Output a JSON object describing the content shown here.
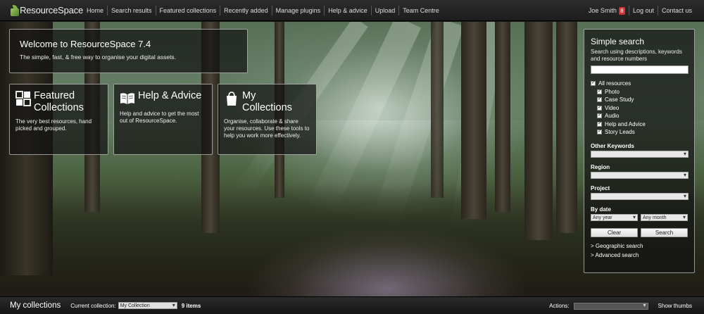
{
  "app": {
    "logo_text": "ResourceSpace"
  },
  "nav": {
    "items": [
      "Home",
      "Search results",
      "Featured collections",
      "Recently added",
      "Manage plugins",
      "Help & advice",
      "Upload",
      "Team Centre"
    ],
    "user_name": "Joe Smith",
    "notification_count": "8",
    "logout": "Log out",
    "contact": "Contact us"
  },
  "welcome": {
    "title": "Welcome to ResourceSpace 7.4",
    "subtitle": "The simple, fast, & free way to organise your digital assets."
  },
  "tiles": [
    {
      "icon": "grid-icon",
      "title_line1": "Featured",
      "title_line2": "Collections",
      "description": "The very best resources, hand picked and grouped."
    },
    {
      "icon": "book-icon",
      "title_line1": "Help & Advice",
      "title_line2": "",
      "description": "Help and advice to get the most out of ResourceSpace."
    },
    {
      "icon": "bag-icon",
      "title_line1": "My",
      "title_line2": "Collections",
      "description": "Organise, collaborate & share your resources. Use these tools to help you work more effectively."
    }
  ],
  "search": {
    "title": "Simple search",
    "subtitle": "Search using descriptions, keywords and resource numbers",
    "input_value": "",
    "all_resources": "All resources",
    "types": [
      "Photo",
      "Case Study",
      "Video",
      "Audio",
      "Help and Advice",
      "Story Leads"
    ],
    "other_keywords": "Other Keywords",
    "region": "Region",
    "project": "Project",
    "by_date": "By date",
    "any_year": "Any year",
    "any_month": "Any month",
    "clear": "Clear",
    "search": "Search",
    "geo_link": "> Geographic search",
    "advanced_link": "> Advanced search"
  },
  "bottom": {
    "title": "My collections",
    "current_label": "Current collection:",
    "current_value": "My Collection",
    "count": "9 items",
    "actions_label": "Actions:",
    "show_thumbs": "Show thumbs"
  }
}
